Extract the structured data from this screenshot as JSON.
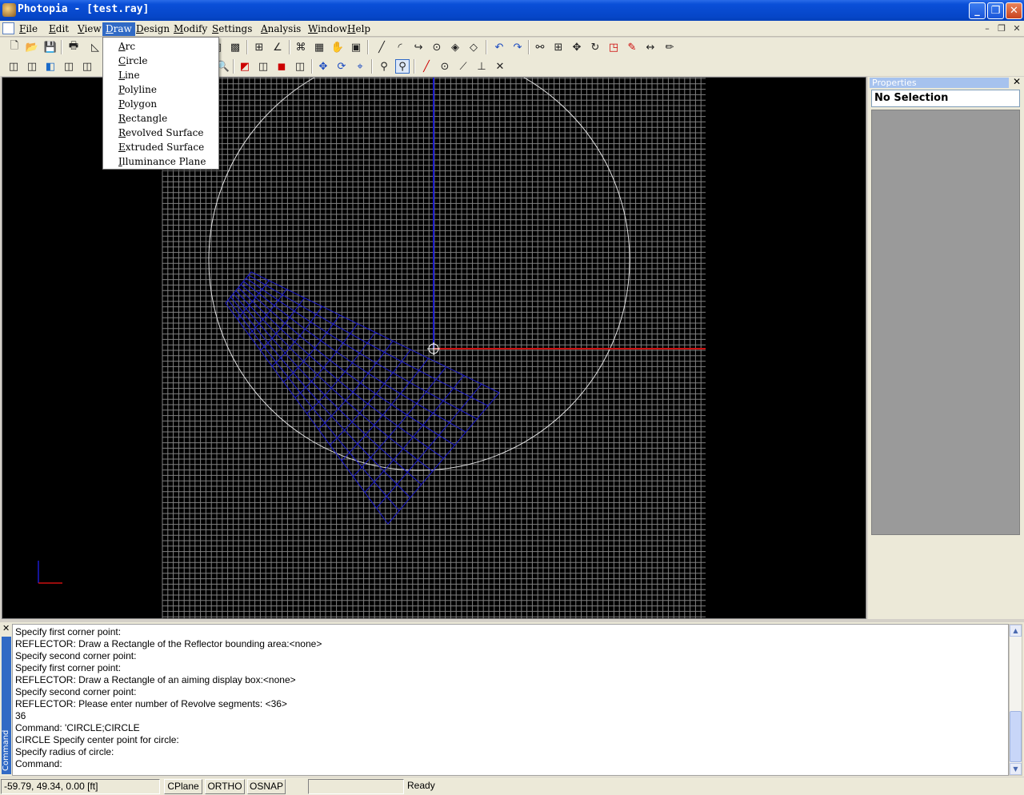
{
  "window": {
    "title": "Photopia - [test.ray]"
  },
  "menubar": {
    "items": [
      {
        "first": "F",
        "rest": "ile"
      },
      {
        "first": "E",
        "rest": "dit"
      },
      {
        "first": "V",
        "rest": "iew"
      },
      {
        "first": "D",
        "rest": "raw"
      },
      {
        "first": "D",
        "rest": "esign"
      },
      {
        "first": "M",
        "rest": "odify"
      },
      {
        "first": "S",
        "rest": "ettings"
      },
      {
        "first": "A",
        "rest": "nalysis"
      },
      {
        "first": "W",
        "rest": "indow"
      },
      {
        "first": "H",
        "rest": "elp"
      }
    ],
    "active": "Draw"
  },
  "draw_menu": {
    "items": [
      {
        "first": "A",
        "rest": "rc"
      },
      {
        "first": "C",
        "rest": "ircle"
      },
      {
        "first": "L",
        "rest": "ine"
      },
      {
        "first": "P",
        "rest": "olyline"
      },
      {
        "first": "P",
        "rest": "olygon"
      },
      {
        "first": "R",
        "rest": "ectangle"
      },
      {
        "first": "R",
        "rest": "evolved Surface"
      },
      {
        "first": "E",
        "rest": "xtruded Surface"
      },
      {
        "first": "I",
        "rest": "lluminance Plane"
      }
    ]
  },
  "properties": {
    "title": "Properties",
    "selection": "No Selection"
  },
  "command": {
    "tab_label": "Command",
    "lines": [
      "Specify first corner point:",
      "REFLECTOR: Draw a Rectangle of the Reflector bounding area:<none>",
      "Specify second corner point:",
      "Specify first corner point:",
      "REFLECTOR: Draw a Rectangle of an aiming display box:<none>",
      "Specify second corner point:",
      "REFLECTOR: Please enter number of Revolve segments: <36>",
      "36",
      "Command: 'CIRCLE;CIRCLE",
      "CIRCLE Specify center point for circle:",
      "Specify radius of circle:",
      "Command:"
    ]
  },
  "statusbar": {
    "coords": "-59.79, 49.34, 0.00 [ft]",
    "cplane": "CPlane",
    "ortho": "ORTHO",
    "osnap": "OSNAP",
    "status": "Ready"
  },
  "colors": {
    "grid": "#808080",
    "reflector": "#1a1acc",
    "y_axis": "#1a1acc",
    "x_axis": "#cc1111",
    "circle": "#e0e0e0"
  }
}
